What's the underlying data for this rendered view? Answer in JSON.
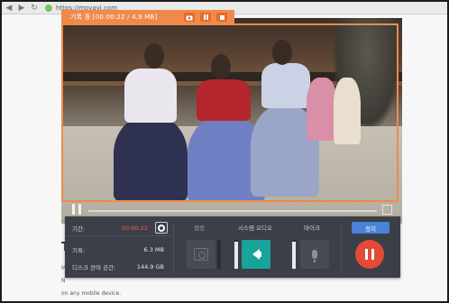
{
  "browser": {
    "url": "https://movavi.com"
  },
  "recording_bar": {
    "title": "기록 중 [00:00:22 / 4.9 MB]",
    "camera_icon": "camera-icon",
    "pause_icon": "pause-icon",
    "stop_icon": "stop-icon",
    "accent": "#f08a4b"
  },
  "page": {
    "heading": "T",
    "line1": "M",
    "line2": "N",
    "line3": "on any mobile device."
  },
  "panel": {
    "duration_label": "기간:",
    "duration_value": "00:00:22",
    "recorded_label": "기록:",
    "recorded_value": "6.3 MB",
    "free_space_label": "디스크 잔여 공간:",
    "free_space_value": "144.9 GB",
    "webcam_label": "웹캠",
    "system_audio_label": "시스템 오디오",
    "mic_label": "마이크",
    "stop_label": "정지",
    "levels": {
      "webcam": 0.0,
      "system_audio": 0.95,
      "mic": 0.95
    },
    "colors": {
      "system_audio": "#1aa39a",
      "pause": "#e24a3a",
      "stop": "#4a82d8",
      "time": "#ff5a4f"
    }
  }
}
